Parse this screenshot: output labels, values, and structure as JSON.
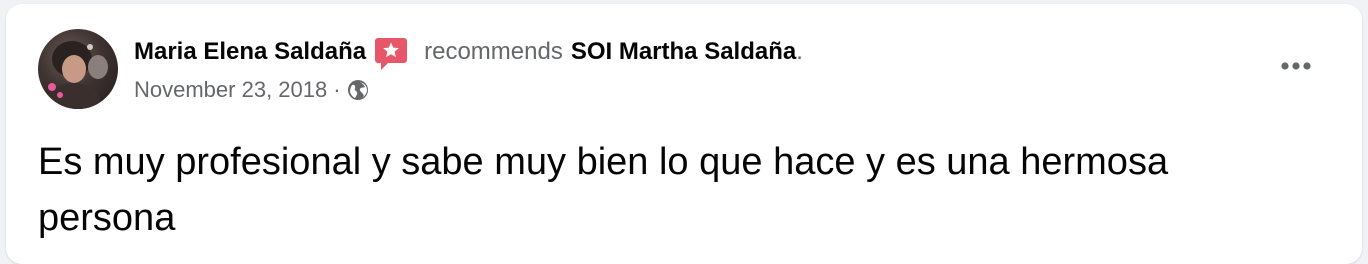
{
  "post": {
    "author": "Maria Elena Saldaña",
    "verb": "recommends",
    "page_name": "SOI Martha Saldaña",
    "period": ".",
    "date": "November 23, 2018",
    "separator": "·",
    "privacy_icon": "globe-icon",
    "recommend_icon": "recommend-star-icon",
    "more_icon": "more-options-icon",
    "text": "Es muy profesional y sabe muy bien lo que hace y es una hermosa persona"
  },
  "colors": {
    "primary_text": "#050505",
    "secondary_text": "#65676b",
    "recommend_badge": "#e8566a",
    "card_background": "#ffffff",
    "page_background": "#f0f2f5"
  }
}
